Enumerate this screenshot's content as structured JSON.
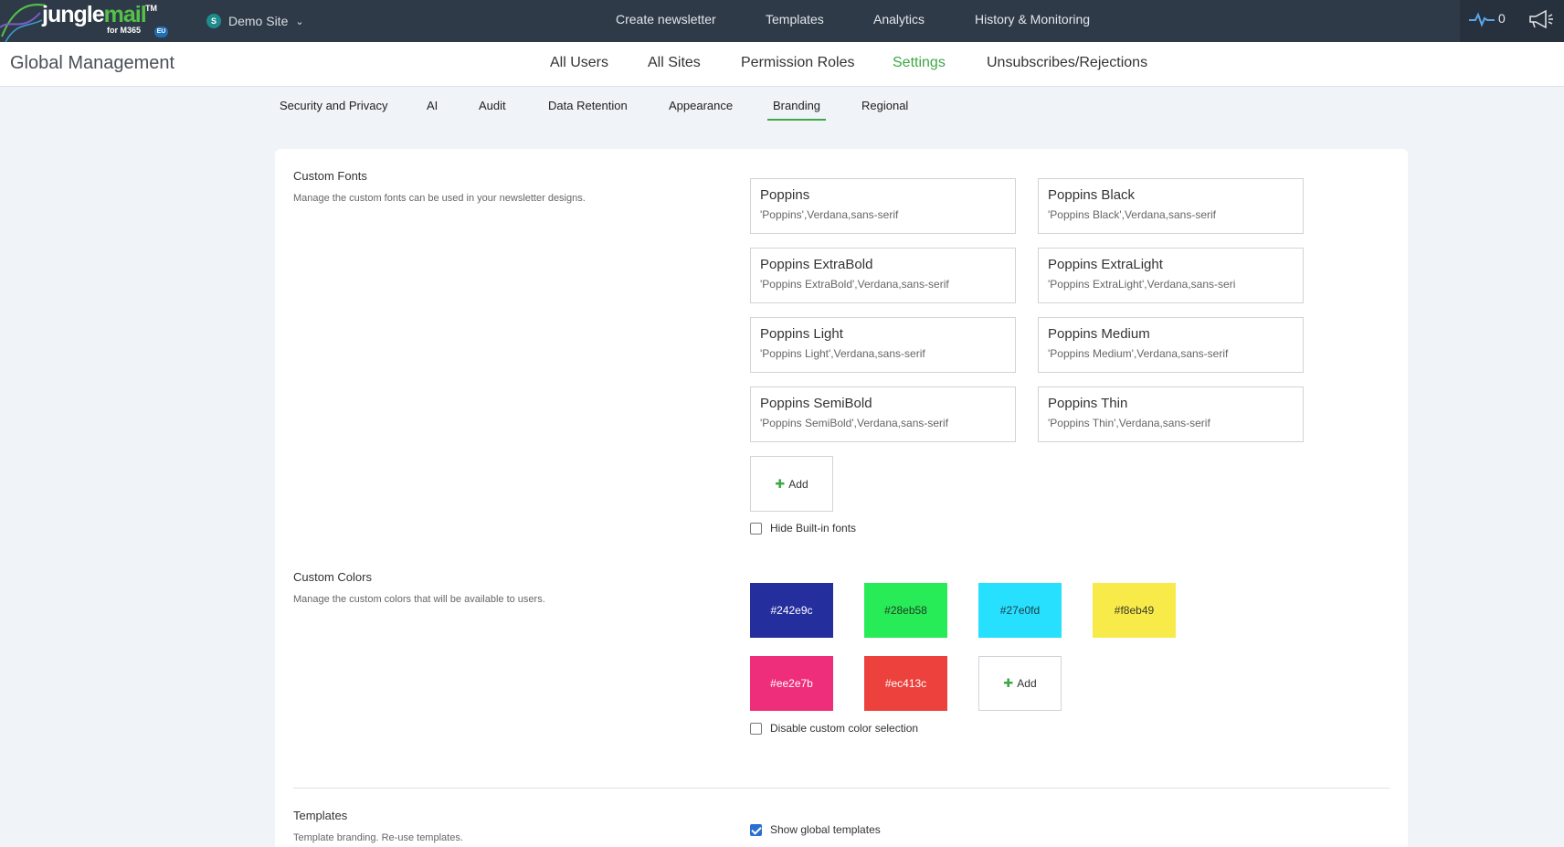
{
  "brand": {
    "logo_main": "jungle",
    "logo_accent": "mail",
    "logo_tm": "TM",
    "logo_sub": "for M365",
    "region_badge": "EU"
  },
  "site_switcher": {
    "icon_letter": "S",
    "label": "Demo Site"
  },
  "top_nav": [
    "Create newsletter",
    "Templates",
    "Analytics",
    "History & Monitoring"
  ],
  "activity": {
    "count": "0"
  },
  "page_title": "Global Management",
  "sub_nav": [
    "All Users",
    "All Sites",
    "Permission Roles",
    "Settings",
    "Unsubscribes/Rejections"
  ],
  "sub_nav_active": "Settings",
  "tabs": [
    "Security and Privacy",
    "AI",
    "Audit",
    "Data Retention",
    "Appearance",
    "Branding",
    "Regional"
  ],
  "active_tab": "Branding",
  "custom_fonts": {
    "title": "Custom Fonts",
    "description": "Manage the custom fonts can be used in your newsletter designs.",
    "fonts": [
      {
        "name": "Poppins",
        "stack": "'Poppins',Verdana,sans-serif"
      },
      {
        "name": "Poppins Black",
        "stack": "'Poppins Black',Verdana,sans-serif"
      },
      {
        "name": "Poppins ExtraBold",
        "stack": "'Poppins ExtraBold',Verdana,sans-serif"
      },
      {
        "name": "Poppins ExtraLight",
        "stack": "'Poppins ExtraLight',Verdana,sans-seri"
      },
      {
        "name": "Poppins Light",
        "stack": "'Poppins Light',Verdana,sans-serif"
      },
      {
        "name": "Poppins Medium",
        "stack": "'Poppins Medium',Verdana,sans-serif"
      },
      {
        "name": "Poppins SemiBold",
        "stack": "'Poppins SemiBold',Verdana,sans-serif"
      },
      {
        "name": "Poppins Thin",
        "stack": "'Poppins Thin',Verdana,sans-serif"
      }
    ],
    "add_label": "Add",
    "hide_builtin_label": "Hide Built-in fonts",
    "hide_builtin_checked": false
  },
  "custom_colors": {
    "title": "Custom Colors",
    "description": "Manage the custom colors that will be available to users.",
    "colors": [
      "#242e9c",
      "#28eb58",
      "#27e0fd",
      "#f8eb49",
      "#ee2e7b",
      "#ec413c"
    ],
    "add_label": "Add",
    "disable_label": "Disable custom color selection",
    "disable_checked": false
  },
  "templates": {
    "title": "Templates",
    "description": "Template branding. Re-use templates.",
    "show_global_label": "Show global templates",
    "show_global_checked": true
  },
  "colors": {
    "topbar": "#2f3a48",
    "accent_green": "#3da844",
    "checkbox_blue": "#2a6fd1"
  }
}
